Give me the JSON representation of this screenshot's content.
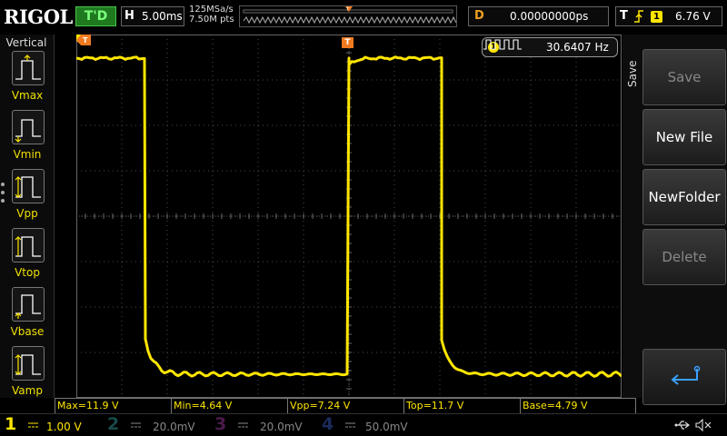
{
  "header": {
    "logo": "RIGOL",
    "trigger_status": "T'D",
    "timebase_key": "H",
    "timebase_value": "5.00ms",
    "sample_rate": "125MSa/s",
    "memory_depth": "7.50M pts",
    "delay_key": "D",
    "delay_value": "0.00000000ps",
    "trigger_key": "T",
    "trigger_source": "1",
    "trigger_level": "6.76 V",
    "trigger_marker": "T"
  },
  "measure_menu": {
    "title": "Vertical",
    "items": [
      {
        "label": "Vmax",
        "icon": "vmax-icon"
      },
      {
        "label": "Vmin",
        "icon": "vmin-icon"
      },
      {
        "label": "Vpp",
        "icon": "vpp-icon"
      },
      {
        "label": "Vtop",
        "icon": "vtop-icon"
      },
      {
        "label": "Vbase",
        "icon": "vbase-icon"
      },
      {
        "label": "Vamp",
        "icon": "vamp-icon"
      }
    ]
  },
  "frequency": {
    "channel": "1",
    "value": "30.6407 Hz"
  },
  "save_menu": {
    "title": "Save",
    "buttons": [
      {
        "label": "Save",
        "enabled": false
      },
      {
        "label": "New File",
        "enabled": true
      },
      {
        "label": "NewFolder",
        "enabled": true
      },
      {
        "label": "Delete",
        "enabled": false
      },
      {
        "label": "",
        "icon": "return-icon",
        "enabled": true
      }
    ]
  },
  "readouts": [
    {
      "text": "Max=11.9 V"
    },
    {
      "text": "Min=4.64 V"
    },
    {
      "text": "Vpp=7.24 V"
    },
    {
      "text": "Top=11.7 V"
    },
    {
      "text": "Base=4.79 V"
    }
  ],
  "channels": [
    {
      "num": "1",
      "scale": "1.00 V",
      "color": "#ffe600",
      "active": true
    },
    {
      "num": "2",
      "scale": "20.0mV",
      "color": "#00c8c8",
      "active": false
    },
    {
      "num": "3",
      "scale": "20.0mV",
      "color": "#e040e0",
      "active": false
    },
    {
      "num": "4",
      "scale": "50.0mV",
      "color": "#3080ff",
      "active": false
    }
  ],
  "colors": {
    "trace": "#ffe600",
    "trigger_marker": "#f07a20",
    "status_green": "#1f7a1f",
    "grid": "#555555"
  }
}
